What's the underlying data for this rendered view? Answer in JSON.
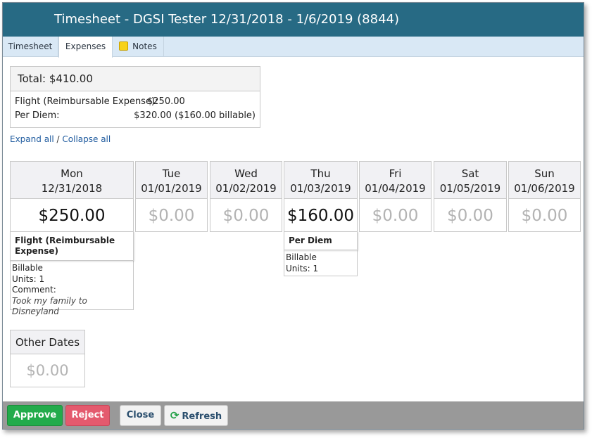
{
  "window": {
    "title": "Timesheet - DGSI Tester 12/31/2018 - 1/6/2019 (8844)"
  },
  "tabs": [
    {
      "label": "Timesheet",
      "active": false
    },
    {
      "label": "Expenses",
      "active": true
    },
    {
      "label": "Notes",
      "icon": "note-icon",
      "active": false
    }
  ],
  "summary": {
    "total": "Total: $410.00",
    "rows": [
      {
        "label": "Flight (Reimbursable Expense):",
        "value": "$250.00"
      },
      {
        "label": "Per Diem:",
        "value": "$320.00 ($160.00 billable)"
      }
    ]
  },
  "links": {
    "expand_all": "Expand all",
    "separator": " / ",
    "collapse_all": "Collapse all"
  },
  "days": [
    {
      "name": "Mon",
      "date": "12/31/2018",
      "amount": "$250.00"
    },
    {
      "name": "Tue",
      "date": "01/01/2019",
      "amount": "$0.00"
    },
    {
      "name": "Wed",
      "date": "01/02/2019",
      "amount": "$0.00"
    },
    {
      "name": "Thu",
      "date": "01/03/2019",
      "amount": "$160.00"
    },
    {
      "name": "Fri",
      "date": "01/04/2019",
      "amount": "$0.00"
    },
    {
      "name": "Sat",
      "date": "01/05/2019",
      "amount": "$0.00"
    },
    {
      "name": "Sun",
      "date": "01/06/2019",
      "amount": "$0.00"
    }
  ],
  "expenses": {
    "mon": {
      "title": "Flight (Reimbursable Expense)",
      "billable": "Billable",
      "units": "Units: 1",
      "comment_label": "Comment:",
      "comment": "Took my family to Disneyland"
    },
    "thu": {
      "title": "Per Diem",
      "billable": "Billable",
      "units": "Units: 1"
    }
  },
  "other_dates": {
    "label": "Other Dates",
    "amount": "$0.00"
  },
  "footer": {
    "approve": "Approve",
    "reject": "Reject",
    "close": "Close",
    "refresh": "Refresh"
  },
  "colors": {
    "titlebar": "#276a84",
    "approve": "#22ab4b",
    "reject": "#e45a6e",
    "footer": "#999999"
  }
}
